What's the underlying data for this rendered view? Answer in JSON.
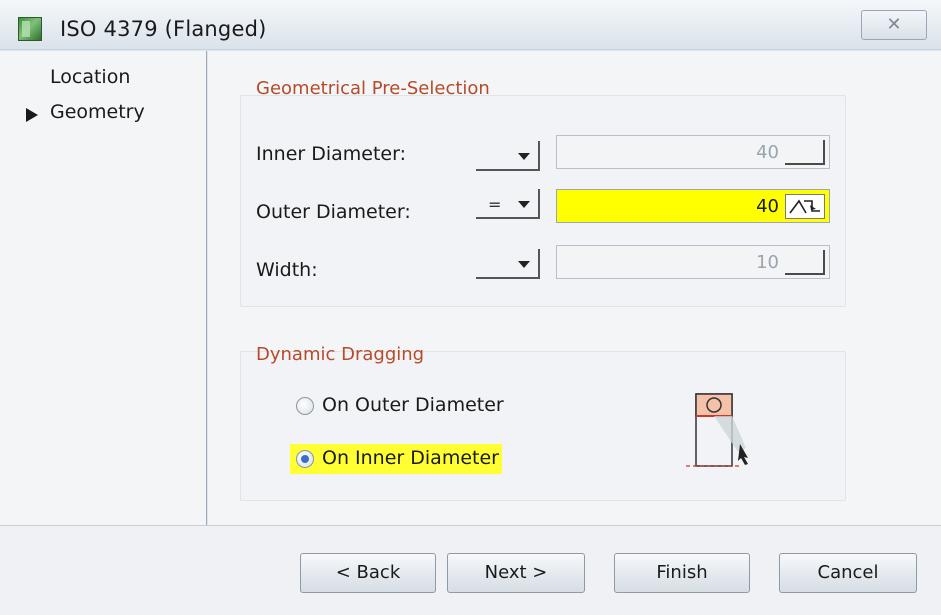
{
  "window": {
    "title": "ISO 4379 (Flanged)",
    "close_glyph": "✕"
  },
  "nav": {
    "items": [
      {
        "label": "Location",
        "selected": false
      },
      {
        "label": "Geometry",
        "selected": true
      }
    ]
  },
  "geometry": {
    "group_title": "Geometrical Pre-Selection",
    "rows": [
      {
        "label": "Inner Diameter:",
        "operator": "",
        "value": "40",
        "enabled": false
      },
      {
        "label": "Outer Diameter:",
        "operator": "=",
        "value": "40",
        "enabled": true
      },
      {
        "label": "Width:",
        "operator": "",
        "value": "10",
        "enabled": false
      }
    ]
  },
  "dragging": {
    "group_title": "Dynamic Dragging",
    "options": [
      {
        "label": "On Outer Diameter",
        "checked": false
      },
      {
        "label": "On Inner Diameter",
        "checked": true
      }
    ]
  },
  "buttons": {
    "back": "< Back",
    "next": "Next >",
    "finish": "Finish",
    "cancel": "Cancel"
  },
  "colors": {
    "accent_title": "#b64b2a",
    "highlight": "#ffff00"
  },
  "icons": {
    "app": "bearing-app-icon",
    "preview": "bearing-drag-preview-icon"
  }
}
